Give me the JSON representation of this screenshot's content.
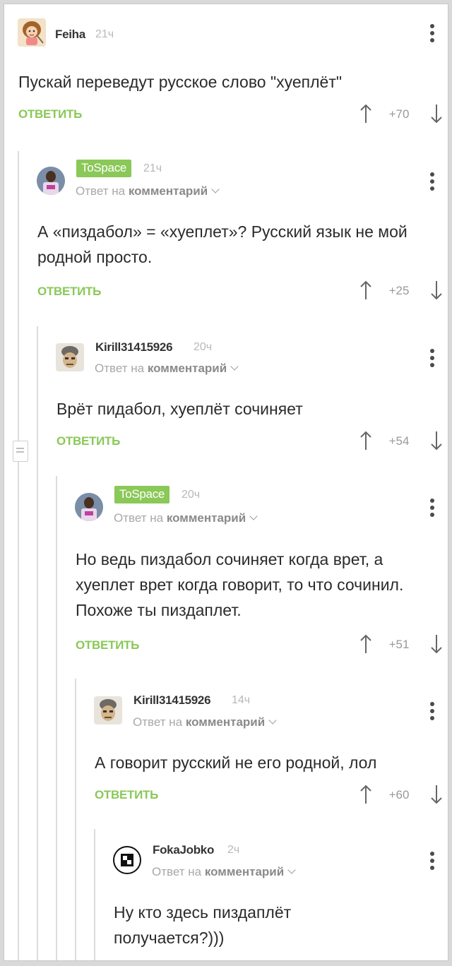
{
  "colors": {
    "accent": "#8ac858",
    "text": "#2b2b2b",
    "muted": "#a8a8a8",
    "background": "#ffffff"
  },
  "comments": [
    {
      "username": "Feiha",
      "badge": false,
      "time": "21ч",
      "reply_to": null,
      "text": "Пускай переведут русское слово \"хуеплёт\"",
      "reply_label": "ОТВЕТИТЬ",
      "score": "+70",
      "avatar": "cartoon-girl-avatar"
    },
    {
      "username": "ToSpace",
      "badge": true,
      "time": "21ч",
      "reply_to_prefix": "Ответ на",
      "reply_to_link": "комментарий",
      "text": "А «пиздабол» = «хуеплет»? Русский язык не мой родной просто.",
      "reply_label": "ОТВЕТИТЬ",
      "score": "+25",
      "avatar": "basketball-player-avatar"
    },
    {
      "username": "Kirill31415926",
      "badge": false,
      "time": "20ч",
      "reply_to_prefix": "Ответ на",
      "reply_to_link": "комментарий",
      "text": "Врёт пидабол, хуеплёт сочиняет",
      "reply_label": "ОТВЕТИТЬ",
      "score": "+54",
      "avatar": "anime-character-avatar"
    },
    {
      "username": "ToSpace",
      "badge": true,
      "time": "20ч",
      "reply_to_prefix": "Ответ на",
      "reply_to_link": "комментарий",
      "text": "Но ведь пиздабол сочиняет когда врет, а хуеплет врет когда говорит, то что сочинил. Похоже ты пиздаплет.",
      "reply_label": "ОТВЕТИТЬ",
      "score": "+51",
      "avatar": "basketball-player-avatar"
    },
    {
      "username": "Kirill31415926",
      "badge": false,
      "time": "14ч",
      "reply_to_prefix": "Ответ на",
      "reply_to_link": "комментарий",
      "text": "А говорит русский не его родной, лол",
      "reply_label": "ОТВЕТИТЬ",
      "score": "+60",
      "avatar": "anime-character-avatar"
    },
    {
      "username": "FokaJobko",
      "badge": false,
      "time": "2ч",
      "reply_to_prefix": "Ответ на",
      "reply_to_link": "комментарий",
      "text": "Ну кто здесь пиздаплёт получается?)))",
      "reply_label": null,
      "score": null,
      "avatar": "black-logo-avatar"
    }
  ]
}
